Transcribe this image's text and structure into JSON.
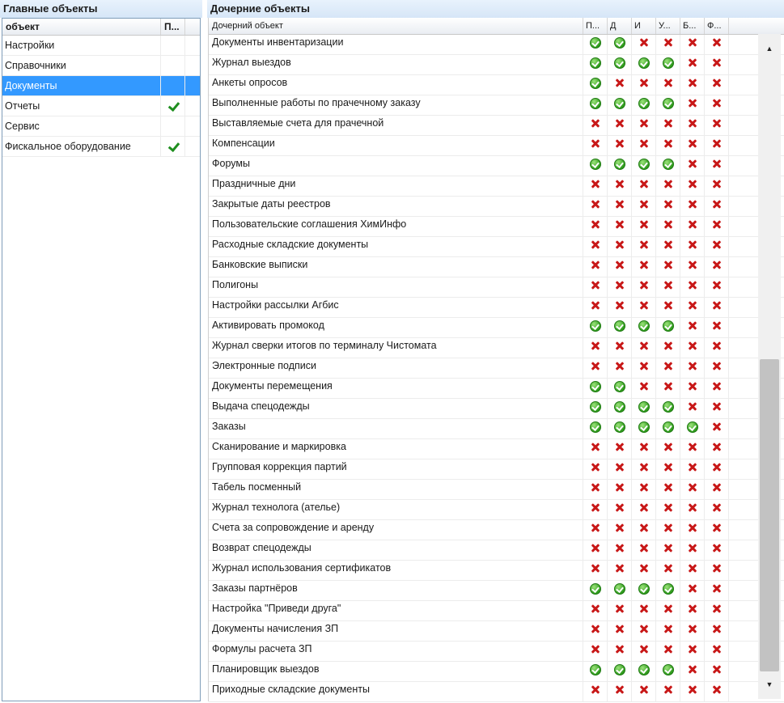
{
  "left_panel": {
    "title": "Главные объекты",
    "headers": [
      "объект",
      "П..."
    ],
    "rows": [
      {
        "name": "Настройки",
        "status": "partial",
        "selected": false
      },
      {
        "name": "Справочники",
        "status": "partial",
        "selected": false
      },
      {
        "name": "Документы",
        "status": "partial",
        "selected": true
      },
      {
        "name": "Отчеты",
        "status": "tick",
        "selected": false
      },
      {
        "name": "Сервис",
        "status": "partial",
        "selected": false
      },
      {
        "name": "Фискальное оборудование",
        "status": "tick",
        "selected": false
      }
    ]
  },
  "right_panel": {
    "title": "Дочерние объекты",
    "headers": [
      "Дочерний объект",
      "П...",
      "Д",
      "И",
      "У...",
      "Б...",
      "Ф..."
    ],
    "rows": [
      {
        "name": "Документы инвентаризации",
        "perms": [
          "ok",
          "ok",
          "no",
          "no",
          "no",
          "no"
        ]
      },
      {
        "name": "Журнал выездов",
        "perms": [
          "ok",
          "ok",
          "ok",
          "ok",
          "no",
          "no"
        ]
      },
      {
        "name": "Анкеты опросов",
        "perms": [
          "ok",
          "no",
          "no",
          "no",
          "no",
          "no"
        ]
      },
      {
        "name": "Выполненные работы по прачечному заказу",
        "perms": [
          "ok",
          "ok",
          "ok",
          "ok",
          "no",
          "no"
        ]
      },
      {
        "name": "Выставляемые счета для прачечной",
        "perms": [
          "no",
          "no",
          "no",
          "no",
          "no",
          "no"
        ]
      },
      {
        "name": "Компенсации",
        "perms": [
          "no",
          "no",
          "no",
          "no",
          "no",
          "no"
        ]
      },
      {
        "name": "Форумы",
        "perms": [
          "ok",
          "ok",
          "ok",
          "ok",
          "no",
          "no"
        ]
      },
      {
        "name": "Праздничные дни",
        "perms": [
          "no",
          "no",
          "no",
          "no",
          "no",
          "no"
        ]
      },
      {
        "name": "Закрытые даты реестров",
        "perms": [
          "no",
          "no",
          "no",
          "no",
          "no",
          "no"
        ]
      },
      {
        "name": "Пользовательские соглашения ХимИнфо",
        "perms": [
          "no",
          "no",
          "no",
          "no",
          "no",
          "no"
        ]
      },
      {
        "name": "Расходные складские документы",
        "perms": [
          "no",
          "no",
          "no",
          "no",
          "no",
          "no"
        ]
      },
      {
        "name": "Банковские выписки",
        "perms": [
          "no",
          "no",
          "no",
          "no",
          "no",
          "no"
        ]
      },
      {
        "name": "Полигоны",
        "perms": [
          "no",
          "no",
          "no",
          "no",
          "no",
          "no"
        ]
      },
      {
        "name": "Настройки рассылки Агбис",
        "perms": [
          "no",
          "no",
          "no",
          "no",
          "no",
          "no"
        ]
      },
      {
        "name": "Активировать промокод",
        "perms": [
          "ok",
          "ok",
          "ok",
          "ok",
          "no",
          "no"
        ]
      },
      {
        "name": "Журнал сверки итогов по терминалу Чистомата",
        "perms": [
          "no",
          "no",
          "no",
          "no",
          "no",
          "no"
        ]
      },
      {
        "name": "Электронные подписи",
        "perms": [
          "no",
          "no",
          "no",
          "no",
          "no",
          "no"
        ]
      },
      {
        "name": "Документы перемещения",
        "perms": [
          "ok",
          "ok",
          "no",
          "no",
          "no",
          "no"
        ]
      },
      {
        "name": "Выдача спецодежды",
        "perms": [
          "ok",
          "ok",
          "ok",
          "ok",
          "no",
          "no"
        ]
      },
      {
        "name": "Заказы",
        "perms": [
          "ok",
          "ok",
          "ok",
          "ok",
          "ok",
          "no"
        ]
      },
      {
        "name": "Сканирование и маркировка",
        "perms": [
          "no",
          "no",
          "no",
          "no",
          "no",
          "no"
        ]
      },
      {
        "name": "Групповая коррекция партий",
        "perms": [
          "no",
          "no",
          "no",
          "no",
          "no",
          "no"
        ]
      },
      {
        "name": "Табель посменный",
        "perms": [
          "no",
          "no",
          "no",
          "no",
          "no",
          "no"
        ]
      },
      {
        "name": "Журнал технолога (ателье)",
        "perms": [
          "no",
          "no",
          "no",
          "no",
          "no",
          "no"
        ]
      },
      {
        "name": "Счета за сопровождение и аренду",
        "perms": [
          "no",
          "no",
          "no",
          "no",
          "no",
          "no"
        ]
      },
      {
        "name": "Возврат спецодежды",
        "perms": [
          "no",
          "no",
          "no",
          "no",
          "no",
          "no"
        ]
      },
      {
        "name": "Журнал использования сертификатов",
        "perms": [
          "no",
          "no",
          "no",
          "no",
          "no",
          "no"
        ]
      },
      {
        "name": "Заказы партнёров",
        "perms": [
          "ok",
          "ok",
          "ok",
          "ok",
          "no",
          "no"
        ]
      },
      {
        "name": "Настройка \"Приведи друга\"",
        "perms": [
          "no",
          "no",
          "no",
          "no",
          "no",
          "no"
        ]
      },
      {
        "name": "Документы начисления ЗП",
        "perms": [
          "no",
          "no",
          "no",
          "no",
          "no",
          "no"
        ]
      },
      {
        "name": "Формулы расчета ЗП",
        "perms": [
          "no",
          "no",
          "no",
          "no",
          "no",
          "no"
        ]
      },
      {
        "name": "Планировщик выездов",
        "perms": [
          "ok",
          "ok",
          "ok",
          "ok",
          "no",
          "no"
        ]
      },
      {
        "name": "Приходные складские документы",
        "perms": [
          "no",
          "no",
          "no",
          "no",
          "no",
          "no"
        ]
      }
    ]
  },
  "scrollbar": {
    "up_icon": "▲",
    "down_icon": "▼",
    "position": 0.52
  },
  "colors": {
    "selection": "#3399ff",
    "ok": "#2e9a1c",
    "no": "#c81818",
    "partial": "#d0502f"
  }
}
